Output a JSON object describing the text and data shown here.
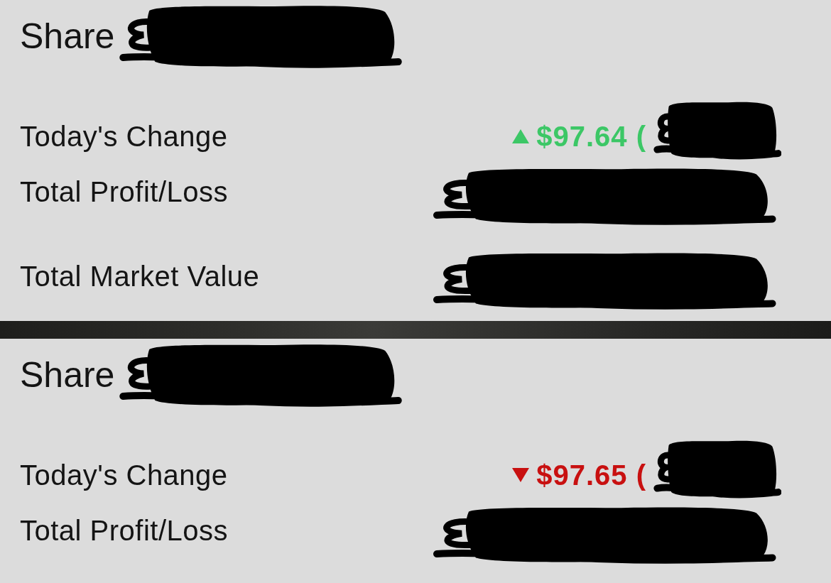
{
  "panels": [
    {
      "title": {
        "text": "Share",
        "redacted": true
      },
      "row_groups": [
        {
          "rows": [
            {
              "label": "Today's Change",
              "value": {
                "rising": true,
                "text": "$97.64 ("
              },
              "value_redacted": true
            },
            {
              "label": "Total Profit/Loss",
              "value_redacted": true
            }
          ]
        },
        {
          "rows": [
            {
              "label": "Total Market Value",
              "value_redacted": true
            }
          ]
        }
      ]
    },
    {
      "title": {
        "text": "Share",
        "redacted": true
      },
      "row_groups": [
        {
          "rows": [
            {
              "label": "Today's Change",
              "value": {
                "rising": false,
                "text": "$97.65 ("
              },
              "value_redacted": true
            },
            {
              "label": "Total Profit/Loss",
              "value_redacted": true
            }
          ]
        }
      ]
    }
  ]
}
